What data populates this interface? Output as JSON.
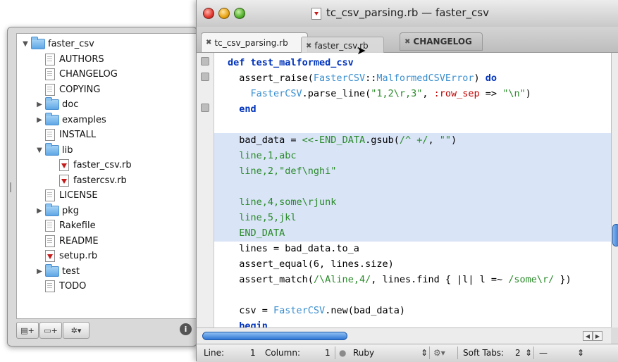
{
  "window": {
    "title": "tc_csv_parsing.rb — faster_csv"
  },
  "tabs": [
    {
      "label": "tc_csv_parsing.rb",
      "close": "✖"
    },
    {
      "label": "faster_csv.rb",
      "close": "✖"
    },
    {
      "label": "CHANGELOG",
      "close": "✖"
    }
  ],
  "project": {
    "items": [
      {
        "label": "faster_csv",
        "type": "folder",
        "expanded": true
      },
      {
        "label": "AUTHORS",
        "type": "file"
      },
      {
        "label": "CHANGELOG",
        "type": "file"
      },
      {
        "label": "COPYING",
        "type": "file"
      },
      {
        "label": "doc",
        "type": "folder",
        "expanded": false
      },
      {
        "label": "examples",
        "type": "folder",
        "expanded": false
      },
      {
        "label": "INSTALL",
        "type": "file"
      },
      {
        "label": "lib",
        "type": "folder",
        "expanded": true
      },
      {
        "label": "faster_csv.rb",
        "type": "ruby"
      },
      {
        "label": "fastercsv.rb",
        "type": "ruby"
      },
      {
        "label": "LICENSE",
        "type": "file"
      },
      {
        "label": "pkg",
        "type": "folder",
        "expanded": false
      },
      {
        "label": "Rakefile",
        "type": "file"
      },
      {
        "label": "README",
        "type": "file"
      },
      {
        "label": "setup.rb",
        "type": "ruby"
      },
      {
        "label": "test",
        "type": "folder",
        "expanded": false
      },
      {
        "label": "TODO",
        "type": "file"
      }
    ],
    "footer_buttons": [
      "▤+",
      "▭+",
      "✲▾"
    ],
    "info_label": "i"
  },
  "code_lines": [
    [
      {
        "t": "def test_malformed_csv",
        "c": "kw"
      }
    ],
    [
      {
        "t": "  assert_raise(",
        "c": "plain"
      },
      {
        "t": "FasterCSV",
        "c": "cls"
      },
      {
        "t": "::",
        "c": "plain"
      },
      {
        "t": "MalformedCSVError",
        "c": "cls"
      },
      {
        "t": ") ",
        "c": "plain"
      },
      {
        "t": "do",
        "c": "kw"
      }
    ],
    [
      {
        "t": "    ",
        "c": "plain"
      },
      {
        "t": "FasterCSV",
        "c": "cls"
      },
      {
        "t": ".parse_line(",
        "c": "plain"
      },
      {
        "t": "\"1,2\\r,3\"",
        "c": "str"
      },
      {
        "t": ", ",
        "c": "plain"
      },
      {
        "t": ":row_sep",
        "c": "sym"
      },
      {
        "t": " => ",
        "c": "plain"
      },
      {
        "t": "\"\\n\"",
        "c": "str"
      },
      {
        "t": ")",
        "c": "plain"
      }
    ],
    [
      {
        "t": "  end",
        "c": "kw"
      }
    ],
    [
      {
        "t": "",
        "c": "plain"
      }
    ],
    [
      {
        "t": "  bad_data = ",
        "c": "plain"
      },
      {
        "t": "<<-END_DATA",
        "c": "str"
      },
      {
        "t": ".gsub(",
        "c": "plain"
      },
      {
        "t": "/^ +/",
        "c": "rgx"
      },
      {
        "t": ", ",
        "c": "plain"
      },
      {
        "t": "\"\"",
        "c": "str"
      },
      {
        "t": ")",
        "c": "plain"
      }
    ],
    [
      {
        "t": "  line,1,abc",
        "c": "str"
      }
    ],
    [
      {
        "t": "  line,2,\"def\\nghi\"",
        "c": "str"
      }
    ],
    [
      {
        "t": "",
        "c": "plain"
      }
    ],
    [
      {
        "t": "  line,4,some\\rjunk",
        "c": "str"
      }
    ],
    [
      {
        "t": "  line,5,jkl",
        "c": "str"
      }
    ],
    [
      {
        "t": "  END_DATA",
        "c": "str"
      }
    ],
    [
      {
        "t": "  lines = bad_data.to_a",
        "c": "plain"
      }
    ],
    [
      {
        "t": "  assert_equal(6, lines.size)",
        "c": "plain"
      }
    ],
    [
      {
        "t": "  assert_match(",
        "c": "plain"
      },
      {
        "t": "/\\Aline,4/",
        "c": "rgx"
      },
      {
        "t": ", lines.find { |l| l =~ ",
        "c": "plain"
      },
      {
        "t": "/some\\r/",
        "c": "rgx"
      },
      {
        "t": " })",
        "c": "plain"
      }
    ],
    [
      {
        "t": "",
        "c": "plain"
      }
    ],
    [
      {
        "t": "  csv = ",
        "c": "plain"
      },
      {
        "t": "FasterCSV",
        "c": "cls"
      },
      {
        "t": ".new(bad_data)",
        "c": "plain"
      }
    ],
    [
      {
        "t": "  begin",
        "c": "kw"
      }
    ]
  ],
  "status": {
    "line_label": "Line:",
    "line_value": "1",
    "column_label": "Column:",
    "column_value": "1",
    "language": "Ruby",
    "language_arrows": "⇕",
    "gear": "⚙▾",
    "soft_tabs_label": "Soft Tabs:",
    "soft_tabs_value": "2",
    "soft_tabs_arrows": "⇕",
    "symbol_value": "—",
    "symbol_arrows": "⇕"
  },
  "colors": {
    "selection": "#d9e4f7",
    "keyword": "#0033bb",
    "string": "#2a8a2a",
    "symbol": "#c00000",
    "class": "#3a8fd0",
    "scroll_thumb": "#2d74d3"
  }
}
